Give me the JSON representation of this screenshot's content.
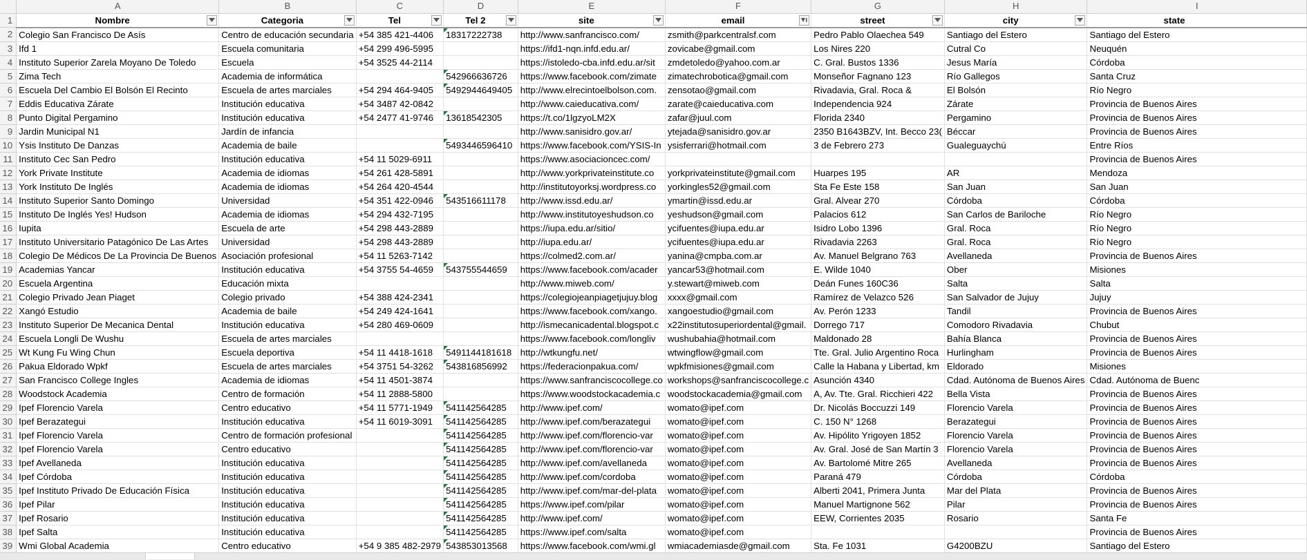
{
  "columns": [
    {
      "letter": "A",
      "header": "Nombre",
      "filter_icon": "dropdown-arrow-icon"
    },
    {
      "letter": "B",
      "header": "Categoria",
      "filter_icon": "dropdown-arrow-icon"
    },
    {
      "letter": "C",
      "header": "Tel",
      "filter_icon": "dropdown-arrow-icon"
    },
    {
      "letter": "D",
      "header": "Tel 2",
      "filter_icon": "dropdown-arrow-icon"
    },
    {
      "letter": "E",
      "header": "site",
      "filter_icon": "dropdown-arrow-icon"
    },
    {
      "letter": "F",
      "header": "email",
      "filter_icon": "sort-filter-icon"
    },
    {
      "letter": "G",
      "header": "street",
      "filter_icon": "dropdown-arrow-icon"
    },
    {
      "letter": "H",
      "header": "city",
      "filter_icon": "dropdown-arrow-icon"
    },
    {
      "letter": "I",
      "header": "state",
      "filter_icon": ""
    }
  ],
  "error_indicator_color": "#1e7a37",
  "rows": [
    {
      "n": "2",
      "cells": [
        "Colegio San Francisco De Asís",
        "Centro de educación secundaria",
        "+54 385 421-4406",
        "18317222738",
        "http://www.sanfrancisco.com/",
        "zsmith@parkcentralsf.com",
        "Pedro Pablo Olaechea 549",
        "Santiago del Estero",
        "Santiago del Estero"
      ],
      "tel2_flag": true
    },
    {
      "n": "3",
      "cells": [
        "Ifd 1",
        "Escuela comunitaria",
        "+54 299 496-5995",
        "",
        "https://ifd1-nqn.infd.edu.ar/",
        "zovicabe@gmail.com",
        "Los Nires 220",
        "Cutral Co",
        "Neuquén"
      ],
      "tel2_flag": false
    },
    {
      "n": "4",
      "cells": [
        "Instituto Superior Zarela Moyano De Toledo",
        "Escuela",
        "+54 3525 44-2114",
        "",
        "https://istoledo-cba.infd.edu.ar/sit",
        "zmdetoledo@yahoo.com.ar",
        "C. Gral. Bustos 1336",
        "Jesus María",
        "Córdoba"
      ],
      "tel2_flag": false
    },
    {
      "n": "5",
      "cells": [
        "Zima Tech",
        "Academia de informática",
        "",
        "542966636726",
        "https://www.facebook.com/zimate",
        "zimatechrobotica@gmail.com",
        "Monseñor Fagnano 123",
        "Río Gallegos",
        "Santa Cruz"
      ],
      "tel2_flag": true
    },
    {
      "n": "6",
      "cells": [
        "Escuela Del Cambio El Bolsón El Recinto",
        "Escuela de artes marciales",
        "+54 294 464-9405",
        "5492944649405",
        "http://www.elrecintoelbolson.com.",
        "zensotao@gmail.com",
        "Rivadavia, Gral. Roca &",
        "El Bolsón",
        "Río Negro"
      ],
      "tel2_flag": true
    },
    {
      "n": "7",
      "cells": [
        "Eddis Educativa Zárate",
        "Institución educativa",
        "+54 3487 42-0842",
        "",
        "http://www.caieducativa.com/",
        "zarate@caieducativa.com",
        "Independencia 924",
        "Zárate",
        "Provincia de Buenos Aires"
      ],
      "tel2_flag": false
    },
    {
      "n": "8",
      "cells": [
        "Punto Digital Pergamino",
        "Institución educativa",
        "+54 2477 41-9746",
        "13618542305",
        "https://t.co/1lgzyoLM2X",
        "zafar@juul.com",
        "Florida 2340",
        "Pergamino",
        "Provincia de Buenos Aires"
      ],
      "tel2_flag": true
    },
    {
      "n": "9",
      "cells": [
        "Jardin Municipal N1",
        "Jardín de infancia",
        "",
        "",
        "http://www.sanisidro.gov.ar/",
        "ytejada@sanisidro.gov.ar",
        "2350 B1643BZV, Int. Becco 23(",
        "Béccar",
        "Provincia de Buenos Aires"
      ],
      "tel2_flag": false
    },
    {
      "n": "10",
      "cells": [
        "Ysis Instituto De Danzas",
        "Academia de baile",
        "",
        "5493446596410",
        "https://www.facebook.com/YSIS-In",
        "ysisferrari@hotmail.com",
        "3 de Febrero 273",
        "Gualeguaychú",
        "Entre Ríos"
      ],
      "tel2_flag": true
    },
    {
      "n": "11",
      "cells": [
        "Instituto Cec San Pedro",
        "Institución educativa",
        "+54 11 5029-6911",
        "",
        "https://www.asociacioncec.com/",
        "",
        "",
        "",
        "Provincia de Buenos Aires"
      ],
      "tel2_flag": false
    },
    {
      "n": "12",
      "cells": [
        "York Private Institute",
        "Academia de idiomas",
        "+54 261 428-5891",
        "",
        "http://www.yorkprivateinstitute.co",
        "yorkprivateinstitute@gmail.com",
        "Huarpes 195",
        "AR",
        "Mendoza"
      ],
      "tel2_flag": false
    },
    {
      "n": "13",
      "cells": [
        "York Instituto De Inglés",
        "Academia de idiomas",
        "+54 264 420-4544",
        "",
        "http://institutoyorksj.wordpress.co",
        "yorkingles52@gmail.com",
        "Sta Fe Este 158",
        "San Juan",
        "San Juan"
      ],
      "tel2_flag": false
    },
    {
      "n": "14",
      "cells": [
        "Instituto Superior Santo Domingo",
        "Universidad",
        "+54 351 422-0946",
        "543516611178",
        "http://www.issd.edu.ar/",
        "ymartin@issd.edu.ar",
        "Gral. Alvear 270",
        "Córdoba",
        "Córdoba"
      ],
      "tel2_flag": true
    },
    {
      "n": "15",
      "cells": [
        "Instituto De Inglés Yes! Hudson",
        "Academia de idiomas",
        "+54 294 432-7195",
        "",
        "http://www.institutoyeshudson.co",
        "yeshudson@gmail.com",
        "Palacios 612",
        "San Carlos de Bariloche",
        "Río Negro"
      ],
      "tel2_flag": false
    },
    {
      "n": "16",
      "cells": [
        "Iupita",
        "Escuela de arte",
        "+54 298 443-2889",
        "",
        "https://iupa.edu.ar/sitio/",
        "ycifuentes@iupa.edu.ar",
        "Isidro Lobo 1396",
        "Gral. Roca",
        "Río Negro"
      ],
      "tel2_flag": false
    },
    {
      "n": "17",
      "cells": [
        "Instituto Universitario Patagónico De Las Artes",
        "Universidad",
        "+54 298 443-2889",
        "",
        "http://iupa.edu.ar/",
        "ycifuentes@iupa.edu.ar",
        "Rivadavia 2263",
        "Gral. Roca",
        "Río Negro"
      ],
      "tel2_flag": false
    },
    {
      "n": "18",
      "cells": [
        "Colegio De Médicos De La Provincia De Buenos",
        "Asociación profesional",
        "+54 11 5263-7142",
        "",
        "https://colmed2.com.ar/",
        "yanina@cmpba.com.ar",
        "Av. Manuel Belgrano 763",
        "Avellaneda",
        "Provincia de Buenos Aires"
      ],
      "tel2_flag": false
    },
    {
      "n": "19",
      "cells": [
        "Academias Yancar",
        "Institución educativa",
        "+54 3755 54-4659",
        "543755544659",
        "https://www.facebook.com/acader",
        "yancar53@hotmail.com",
        "E. Wilde 1040",
        "Ober",
        "Misiones"
      ],
      "tel2_flag": true
    },
    {
      "n": "20",
      "cells": [
        "Escuela Argentina",
        "Educación mixta",
        "",
        "",
        "http://www.miweb.com/",
        "y.stewart@miweb.com",
        "Deán Funes 160C36",
        "Salta",
        "Salta"
      ],
      "tel2_flag": false
    },
    {
      "n": "21",
      "cells": [
        "Colegio Privado Jean Piaget",
        "Colegio privado",
        "+54 388 424-2341",
        "",
        "https://colegiojeanpiagetjujuy.blog",
        "xxxx@gmail.com",
        "Ramírez de Velazco 526",
        "San Salvador de Jujuy",
        "Jujuy"
      ],
      "tel2_flag": false
    },
    {
      "n": "22",
      "cells": [
        "Xangó Estudio",
        "Academia de baile",
        "+54 249 424-1641",
        "",
        "https://www.facebook.com/xango.",
        "xangoestudio@gmail.com",
        "Av. Perón 1233",
        "Tandil",
        "Provincia de Buenos Aires"
      ],
      "tel2_flag": false
    },
    {
      "n": "23",
      "cells": [
        "Instituto Superior De Mecanica Dental",
        "Institución educativa",
        "+54 280 469-0609",
        "",
        "http://ismecanicadental.blogspot.c",
        "x22institutosuperiordental@gmail.",
        "Dorrego 717",
        "Comodoro Rivadavia",
        "Chubut"
      ],
      "tel2_flag": false
    },
    {
      "n": "24",
      "cells": [
        "Escuela Longli De Wushu",
        "Escuela de artes marciales",
        "",
        "",
        "https://www.facebook.com/longliv",
        "wushubahia@hotmail.com",
        "Maldonado 28",
        "Bahía Blanca",
        "Provincia de Buenos Aires"
      ],
      "tel2_flag": false
    },
    {
      "n": "25",
      "cells": [
        "Wt Kung Fu Wing Chun",
        "Escuela deportiva",
        "+54 11 4418-1618",
        "5491144181618",
        "http://wtkungfu.net/",
        "wtwingflow@gmail.com",
        "Tte. Gral. Julio Argentino Roca",
        "Hurlingham",
        "Provincia de Buenos Aires"
      ],
      "tel2_flag": true
    },
    {
      "n": "26",
      "cells": [
        "Pakua Eldorado Wpkf",
        "Escuela de artes marciales",
        "+54 3751 54-3262",
        "543816856992",
        "https://federacionpakua.com/",
        "wpkfmisiones@gmail.com",
        "Calle la Habana y Libertad, km",
        "Eldorado",
        "Misiones"
      ],
      "tel2_flag": true
    },
    {
      "n": "27",
      "cells": [
        "San Francisco College Ingles",
        "Academia de idiomas",
        "+54 11 4501-3874",
        "",
        "https://www.sanfranciscocollege.co",
        "workshops@sanfranciscocollege.c",
        "Asunción 4340",
        "Cdad. Autónoma de Buenos Aires",
        "Cdad. Autónoma de Buenc"
      ],
      "tel2_flag": false
    },
    {
      "n": "28",
      "cells": [
        "Woodstock Academia",
        "Centro de formación",
        "+54 11 2888-5800",
        "",
        "https://www.woodstockacademia.c",
        "woodstockacademia@gmail.com",
        "A, Av. Tte. Gral. Ricchieri 422",
        "Bella Vista",
        "Provincia de Buenos Aires"
      ],
      "tel2_flag": false
    },
    {
      "n": "29",
      "cells": [
        "Ipef Florencio Varela",
        "Centro educativo",
        "+54 11 5771-1949",
        "541142564285",
        "http://www.ipef.com/",
        "womato@ipef.com",
        "Dr. Nicolás Boccuzzi 149",
        "Florencio Varela",
        "Provincia de Buenos Aires"
      ],
      "tel2_flag": true
    },
    {
      "n": "30",
      "cells": [
        "Ipef Berazategui",
        "Institución educativa",
        "+54 11 6019-3091",
        "541142564285",
        "http://www.ipef.com/berazategui",
        "womato@ipef.com",
        "C. 150 N° 1268",
        "Berazategui",
        "Provincia de Buenos Aires"
      ],
      "tel2_flag": true
    },
    {
      "n": "31",
      "cells": [
        "Ipef Florencio Varela",
        "Centro de formación profesional",
        "",
        "541142564285",
        "http://www.ipef.com/florencio-var",
        "womato@ipef.com",
        "Av. Hipólito Yrigoyen 1852",
        "Florencio Varela",
        "Provincia de Buenos Aires"
      ],
      "tel2_flag": true
    },
    {
      "n": "32",
      "cells": [
        "Ipef Florencio Varela",
        "Centro educativo",
        "",
        "541142564285",
        "http://www.ipef.com/florencio-var",
        "womato@ipef.com",
        "Av. Gral. José de San Martín 3",
        "Florencio Varela",
        "Provincia de Buenos Aires"
      ],
      "tel2_flag": true
    },
    {
      "n": "33",
      "cells": [
        "Ipef Avellaneda",
        "Institución educativa",
        "",
        "541142564285",
        "http://www.ipef.com/avellaneda",
        "womato@ipef.com",
        "Av. Bartolomé Mitre 265",
        "Avellaneda",
        "Provincia de Buenos Aires"
      ],
      "tel2_flag": true
    },
    {
      "n": "34",
      "cells": [
        "Ipef Córdoba",
        "Institución educativa",
        "",
        "541142564285",
        "http://www.ipef.com/cordoba",
        "womato@ipef.com",
        "Paraná 479",
        "Córdoba",
        "Córdoba"
      ],
      "tel2_flag": true
    },
    {
      "n": "35",
      "cells": [
        "Ipef Instituto Privado De Educación Física",
        "Institución educativa",
        "",
        "541142564285",
        "http://www.ipef.com/mar-del-plata",
        "womato@ipef.com",
        "Alberti 2041, Primera Junta",
        "Mar del Plata",
        "Provincia de Buenos Aires"
      ],
      "tel2_flag": true
    },
    {
      "n": "36",
      "cells": [
        "Ipef Pilar",
        "Institución educativa",
        "",
        "541142564285",
        "https://www.ipef.com/pilar",
        "womato@ipef.com",
        "Manuel Martignone 562",
        "Pilar",
        "Provincia de Buenos Aires"
      ],
      "tel2_flag": true
    },
    {
      "n": "37",
      "cells": [
        "Ipef Rosario",
        "Institución educativa",
        "",
        "541142564285",
        "http://www.ipef.com/",
        "womato@ipef.com",
        "EEW, Corrientes 2035",
        "Rosario",
        "Santa Fe"
      ],
      "tel2_flag": true
    },
    {
      "n": "38",
      "cells": [
        "Ipef Salta",
        "Institución educativa",
        "",
        "541142564285",
        "https://www.ipef.com/salta",
        "womato@ipef.com",
        "",
        "",
        "Provincia de Buenos Aires"
      ],
      "tel2_flag": true
    },
    {
      "n": "39",
      "cells": [
        "Wmi Global Academia",
        "Centro educativo",
        "+54 9 385 482-2979",
        "543853013568",
        "https://www.facebook.com/wmi.gl",
        "wmiacademiasde@gmail.com",
        "Sta. Fe 1031",
        "G4200BZU",
        "Santiago del Estero"
      ],
      "tel2_flag": true
    }
  ]
}
